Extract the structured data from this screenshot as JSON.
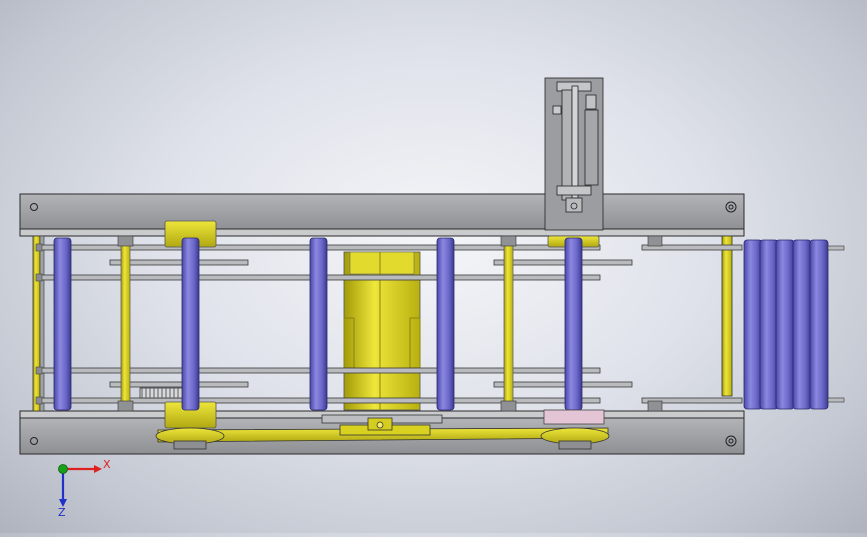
{
  "viewport": {
    "name": "cad-graphics-area",
    "background": "#dfe2ea"
  },
  "colors": {
    "frame": "#9a9c9f",
    "frame_edge": "#2a2a2a",
    "roller_blue": "#6a67c8",
    "yellow_part": "#d4cc1e",
    "axis_x": "#e02020",
    "axis_y": "#18a018",
    "axis_z": "#2030c8",
    "pad_pink": "#e3c5d6"
  },
  "triad": {
    "x_label": "X",
    "z_label": "Z"
  }
}
